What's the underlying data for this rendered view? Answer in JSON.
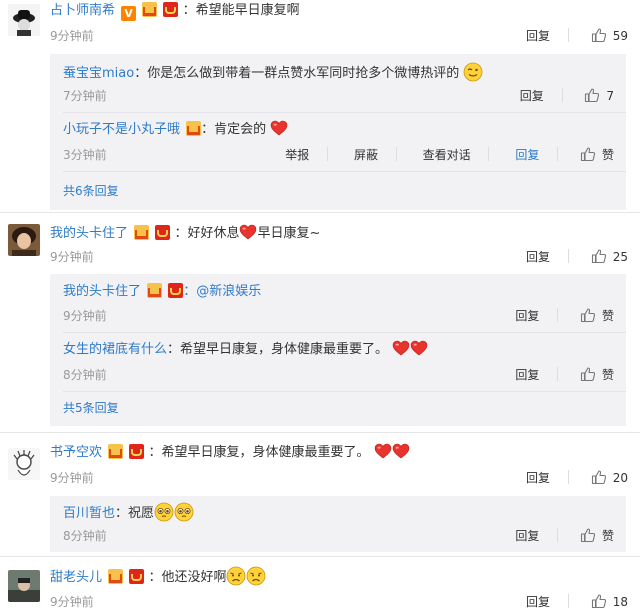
{
  "comments": [
    {
      "user": "占卜师南希",
      "text": "：希望能早日康复啊",
      "time": "9分钟前",
      "reply": "回复",
      "likes": "59",
      "replies": [
        {
          "user": "蚕宝宝miao",
          "text": "：你是怎么做到带着一群点赞水军同时抢多个微博热评的",
          "time": "7分钟前",
          "reply": "回复",
          "likes": "7"
        },
        {
          "user": "小玩子不是小丸子哦",
          "text": "：肯定会的",
          "time": "3分钟前",
          "report": "举报",
          "block": "屏蔽",
          "view": "查看对话",
          "reply": "回复",
          "likes": "赞"
        }
      ],
      "more": "共6条回复"
    },
    {
      "user": "我的头卡住了",
      "text": "：好好休息",
      "text2": "早日康复~",
      "time": "9分钟前",
      "reply": "回复",
      "likes": "25",
      "replies": [
        {
          "user": "我的头卡住了",
          "text": "：@新浪娱乐",
          "time": "9分钟前",
          "reply": "回复",
          "likes": "赞"
        },
        {
          "user": "女生的裙底有什么",
          "text": "：希望早日康复，身体健康最重要了。",
          "time": "8分钟前",
          "reply": "回复",
          "likes": "赞"
        }
      ],
      "more": "共5条回复"
    },
    {
      "user": "书予空欢",
      "text": "：希望早日康复，身体健康最重要了。",
      "time": "9分钟前",
      "reply": "回复",
      "likes": "20",
      "replies": [
        {
          "user": "百川暂也",
          "text": "：祝愿",
          "time": "8分钟前",
          "reply": "回复",
          "likes": "赞"
        }
      ]
    },
    {
      "user": "甜老头儿",
      "text": "：他还没好啊",
      "time": "9分钟前",
      "reply": "回复",
      "likes": "18"
    }
  ],
  "icons": {
    "thumb": "thumbs-up-icon",
    "heart": "heart-emoji",
    "wink": "wink-emoji",
    "pleading": "pleading-emoji",
    "sad": "sad-emoji"
  },
  "colors": {
    "link": "#2e7bc9",
    "reply_bg": "#f2f2f5",
    "time": "#999999"
  }
}
